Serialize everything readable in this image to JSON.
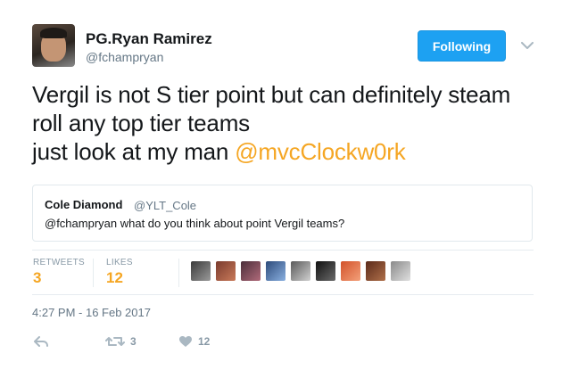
{
  "author": {
    "name": "PG.Ryan Ramirez",
    "handle": "@fchampryan",
    "avatar_icon": "user-photo"
  },
  "follow_button": {
    "label": "Following",
    "color": "#1da1f2"
  },
  "more_icon": "chevron-down-icon",
  "tweet": {
    "line1": "Vergil is not S tier point but can definitely steam",
    "line2": "roll any top tier teams",
    "line3": "just look at my man",
    "mention": "@mvcClockw0rk",
    "mention_color": "#f5a623"
  },
  "quoted_tweet": {
    "name": "Cole Diamond",
    "handle": "@YLT_Cole",
    "text": "@fchampryan what do you think about point Vergil teams?"
  },
  "stats": {
    "retweets_label": "RETWEETS",
    "retweets_count": "3",
    "likes_label": "LIKES",
    "likes_count": "12",
    "liker_avatar_count": 9
  },
  "timestamp": "4:27 PM - 16 Feb 2017",
  "actions": {
    "reply_icon": "reply-icon",
    "retweet_icon": "retweet-icon",
    "retweet_count": "3",
    "like_icon": "heart-icon",
    "like_count": "12"
  }
}
